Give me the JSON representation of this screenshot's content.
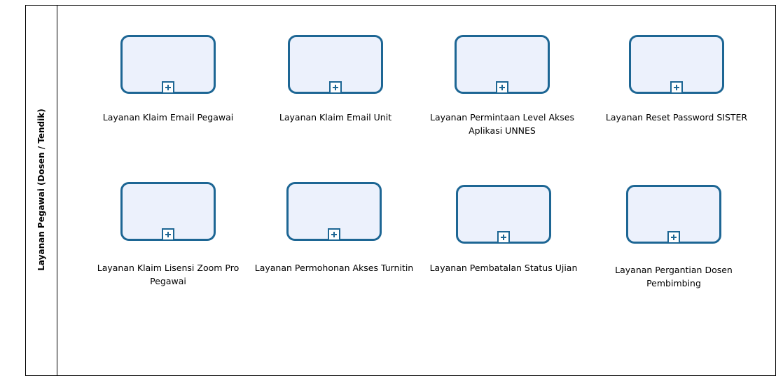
{
  "lane": {
    "title": "Layanan Pegawai (Dosen / Tendik)"
  },
  "tasks": [
    {
      "label": "Layanan Klaim Email Pegawai"
    },
    {
      "label": "Layanan Klaim Email Unit"
    },
    {
      "label": "Layanan Permintaan Level Akses Aplikasi UNNES"
    },
    {
      "label": "Layanan Reset Password SISTER"
    },
    {
      "label": "Layanan Klaim Lisensi Zoom Pro Pegawai"
    },
    {
      "label": "Layanan Permohonan Akses Turnitin"
    },
    {
      "label": "Layanan Pembatalan Status Ujian"
    },
    {
      "label": "Layanan Pergantian Dosen Pembimbing"
    }
  ],
  "colors": {
    "task_border": "#1d6694",
    "task_fill": "#ecf1fc"
  },
  "icons": {
    "subprocess_marker": "plus-icon"
  }
}
